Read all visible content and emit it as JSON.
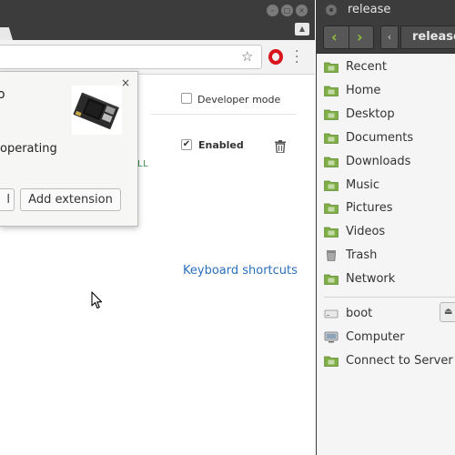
{
  "chrome": {
    "window_buttons": {
      "minimize": "–",
      "maximize": "□",
      "close": "×"
    },
    "profile_glyph": "▲",
    "developer_mode_label": "Developer mode",
    "extension": {
      "enabled_label": "Enabled",
      "link_fragment": "LL"
    },
    "keyboard_shortcuts_label": "Keyboard shortcuts",
    "popup": {
      "title_fragment": "o",
      "body_fragment": "operating",
      "close_glyph": "×",
      "cancel_fragment": "l",
      "add_button_label": "Add extension"
    }
  },
  "nemo": {
    "title": "release",
    "path_left_glyph": "‹",
    "path_label": "release",
    "back_glyph": "‹",
    "forward_glyph": "›",
    "sidebar_items": [
      {
        "label": "Recent",
        "icon": "recent-folder-icon"
      },
      {
        "label": "Home",
        "icon": "home-folder-icon"
      },
      {
        "label": "Desktop",
        "icon": "desktop-folder-icon"
      },
      {
        "label": "Documents",
        "icon": "documents-folder-icon"
      },
      {
        "label": "Downloads",
        "icon": "downloads-folder-icon"
      },
      {
        "label": "Music",
        "icon": "music-folder-icon"
      },
      {
        "label": "Pictures",
        "icon": "pictures-folder-icon"
      },
      {
        "label": "Videos",
        "icon": "videos-folder-icon"
      },
      {
        "label": "Trash",
        "icon": "trash-icon"
      },
      {
        "label": "Network",
        "icon": "network-folder-icon"
      }
    ],
    "device_items": [
      {
        "label": "boot",
        "icon": "drive-icon"
      },
      {
        "label": "Computer",
        "icon": "computer-icon"
      },
      {
        "label": "Connect to Server",
        "icon": "server-folder-icon"
      }
    ],
    "eject_glyph": "⏏"
  },
  "colors": {
    "titlebar": "#3c3c3c",
    "folder_green": "#7fae45",
    "nav_arrow_green": "#8fc03b",
    "link_blue": "#2a6fbb",
    "opera_red": "#d8141c"
  }
}
